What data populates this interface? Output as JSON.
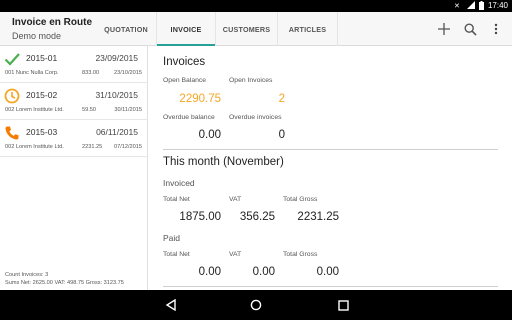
{
  "status_bar": {
    "time": "17:40"
  },
  "app_bar": {
    "title": "Invoice en Route",
    "subtitle": "Demo mode",
    "tabs": [
      {
        "label": "QUOTATION"
      },
      {
        "label": "INVOICE"
      },
      {
        "label": "CUSTOMERS"
      },
      {
        "label": "ARTICLES"
      }
    ],
    "active_tab": "INVOICE",
    "accent_color": "#2aa198"
  },
  "invoice_list": {
    "items": [
      {
        "number": "2015-01",
        "date": "23/09/2015",
        "customer": "001 Nunc Nulla Corp.",
        "amount": "833.00",
        "due": "23/10/2015",
        "status_icon": "check-icon",
        "status_color": "#4caf50"
      },
      {
        "number": "2015-02",
        "date": "31/10/2015",
        "customer": "002 Lorem Institute Ltd.",
        "amount": "59.50",
        "due": "30/11/2015",
        "status_icon": "clock-icon",
        "status_color": "#f5a623"
      },
      {
        "number": "2015-03",
        "date": "06/11/2015",
        "customer": "002 Lorem Institute Ltd.",
        "amount": "2231.25",
        "due": "07/12/2015",
        "status_icon": "phone-icon",
        "status_color": "#f57c00"
      }
    ],
    "footer_count": "Count Invoices: 3",
    "footer_sums": "Sums Net: 2625.00  VAT: 498.75  Gross: 3123.75"
  },
  "invoices_section": {
    "title": "Invoices",
    "open_balance_label": "Open Balance",
    "open_balance_value": "2290.75",
    "open_invoices_label": "Open Invoices",
    "open_invoices_value": "2",
    "overdue_balance_label": "Overdue balance",
    "overdue_balance_value": "0.00",
    "overdue_invoices_label": "Overdue invoices",
    "overdue_invoices_value": "0",
    "highlight_color": "#f5a623"
  },
  "month_section": {
    "title": "This month (November)",
    "invoiced": {
      "title": "Invoiced",
      "net_label": "Total Net",
      "net_value": "1875.00",
      "vat_label": "VAT",
      "vat_value": "356.25",
      "gross_label": "Total Gross",
      "gross_value": "2231.25"
    },
    "paid": {
      "title": "Paid",
      "net_label": "Total Net",
      "net_value": "0.00",
      "vat_label": "VAT",
      "vat_value": "0.00",
      "gross_label": "Total Gross",
      "gross_value": "0.00"
    }
  }
}
